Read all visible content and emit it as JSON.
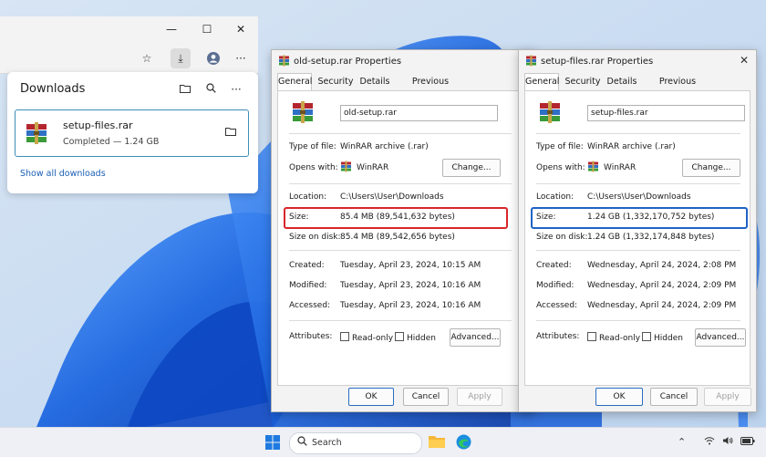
{
  "browser": {
    "window_controls": {
      "minimize": "—",
      "maximize": "☐",
      "close": "✕"
    },
    "toolbar": {
      "favorite_icon": "☆",
      "download_icon": "⤓",
      "more_icon": "···"
    }
  },
  "downloads": {
    "title": "Downloads",
    "item": {
      "name": "setup-files.rar",
      "status": "Completed — 1.24 GB"
    },
    "show_all": "Show all downloads"
  },
  "tabs": [
    "General",
    "Security",
    "Details",
    "Previous Versions"
  ],
  "labels": {
    "type": "Type of file:",
    "opens": "Opens with:",
    "location": "Location:",
    "size": "Size:",
    "size_disk": "Size on disk:",
    "created": "Created:",
    "modified": "Modified:",
    "accessed": "Accessed:",
    "attributes": "Attributes:",
    "read_only": "Read-only",
    "hidden": "Hidden",
    "change": "Change...",
    "advanced": "Advanced...",
    "ok": "OK",
    "cancel": "Cancel",
    "apply": "Apply"
  },
  "dialog1": {
    "title": "old-setup.rar Properties",
    "filename": "old-setup.rar",
    "type": "WinRAR archive (.rar)",
    "opens_with": "WinRAR",
    "location": "C:\\Users\\User\\Downloads",
    "size": "85.4 MB (89,541,632 bytes)",
    "size_disk": "85.4 MB (89,542,656 bytes)",
    "created": "Tuesday, April 23, 2024, 10:15 AM",
    "modified": "Tuesday, April 23, 2024, 10:16 AM",
    "accessed": "Tuesday, April 23, 2024, 10:16 AM",
    "highlight_color": "#d9262b"
  },
  "dialog2": {
    "title": "setup-files.rar Properties",
    "filename": "setup-files.rar",
    "type": "WinRAR archive (.rar)",
    "opens_with": "WinRAR",
    "location": "C:\\Users\\User\\Downloads",
    "size": "1.24 GB (1,332,170,752 bytes)",
    "size_disk": "1.24 GB (1,332,174,848 bytes)",
    "created": "Wednesday, April 24, 2024, 2:08 PM",
    "modified": "Wednesday, April 24, 2024, 2:09 PM",
    "accessed": "Wednesday, April 24, 2024, 2:09 PM",
    "highlight_color": "#1f63c6"
  },
  "taskbar": {
    "search_placeholder": "Search"
  },
  "colors": {
    "accent": "#2a6cc2",
    "link": "#1a5fb4",
    "wallpaper": "#1e6ee6"
  }
}
